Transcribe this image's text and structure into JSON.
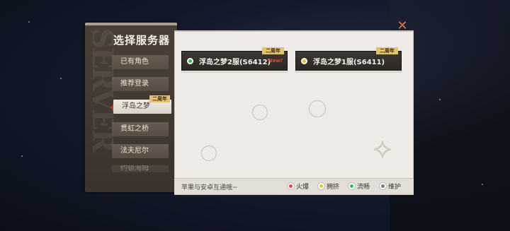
{
  "panel": {
    "title": "选择服务器",
    "watermark": "SERVER"
  },
  "nav": {
    "items": [
      {
        "label": "已有角色"
      },
      {
        "label": "推荐登录"
      },
      {
        "label": "浮岛之梦",
        "tag": "二周年",
        "active": true
      },
      {
        "label": "贯虹之桥"
      },
      {
        "label": "法夫尼尔"
      },
      {
        "label": "约顿海姆"
      }
    ]
  },
  "servers": [
    {
      "name": "浮岛之梦2服(S6412)",
      "tag": "二周年",
      "badge": "New!",
      "status_color": "#2fbf54"
    },
    {
      "name": "浮岛之梦1服(S6411)",
      "tag": "二周年",
      "status_color": "#e9c23b"
    }
  ],
  "footer": {
    "note": "苹果与安卓互通哦~",
    "legend": [
      {
        "label": "火爆",
        "color": "#e04a4a"
      },
      {
        "label": "拥挤",
        "color": "#e9c23b"
      },
      {
        "label": "流畅",
        "color": "#2fbf54"
      },
      {
        "label": "维护",
        "color": "#7b7b7b"
      }
    ]
  },
  "icons": {
    "close": "close-icon",
    "dragon": "dragon-emblem-icon"
  },
  "colors": {
    "accent": "#e2773b",
    "tag_gold": "#e3c372"
  }
}
